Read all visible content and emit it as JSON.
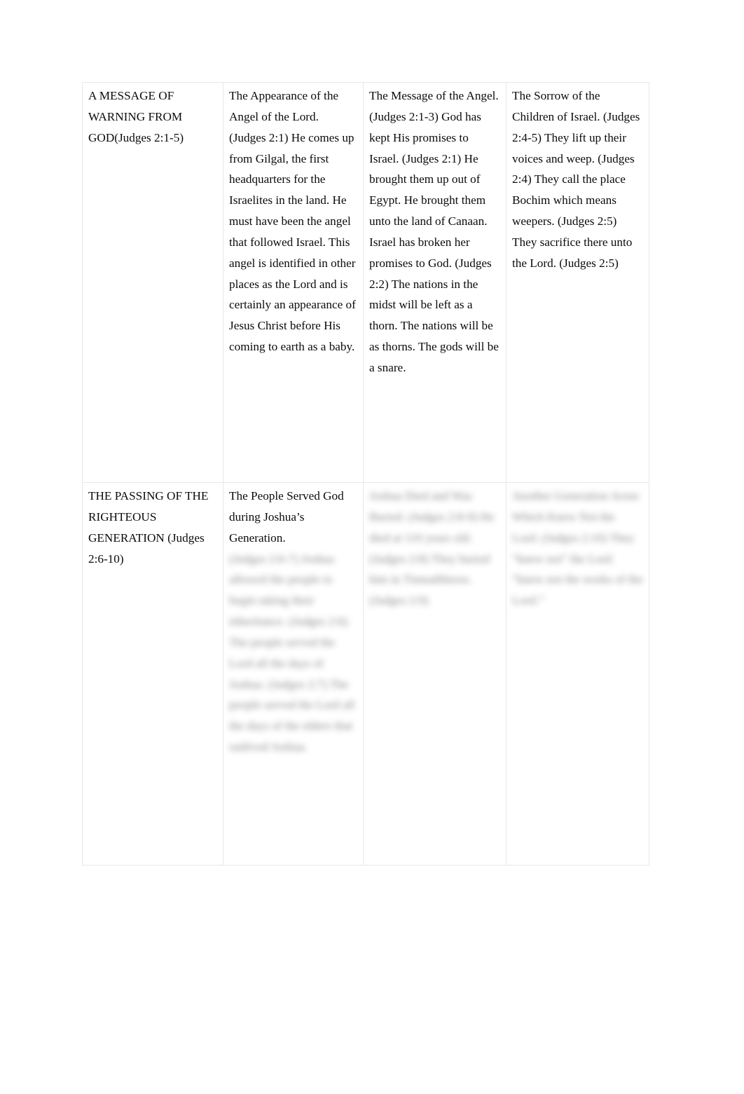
{
  "document": {
    "type": "table",
    "page_background": "#ffffff",
    "text_color": "#0b0b0b",
    "border_color": "#e8e8e8",
    "columns": 4,
    "rows": 2
  },
  "table": {
    "rows": [
      {
        "row_name": "message-of-warning-row",
        "cells": [
          {
            "name": "section-heading-cell",
            "clear": "A MESSAGE OF WARNING FROM GOD(Judges 2:1-5)",
            "blurred": "",
            "obscured": false
          },
          {
            "name": "appearance-of-the-angel-cell",
            "clear": "The Appearance of the Angel of the Lord. (Judges 2:1) He comes up from Gilgal, the first headquarters for the Israelites in the land. He must have been the angel that followed Israel. This angel is identified in other places as the Lord and is certainly an appearance of Jesus Christ before His coming to earth as a baby.",
            "blurred": "",
            "obscured": false
          },
          {
            "name": "message-of-the-angel-cell",
            "clear": "The Message of the Angel. (Judges 2:1-3) God has kept His promises to Israel. (Judges 2:1) He brought them up out of Egypt. He brought them unto the land of Canaan. Israel has broken her promises to God. (Judges 2:2) The nations in the midst will be left as a thorn. The nations will be as thorns. The gods will be a snare.",
            "blurred": "",
            "obscured": false
          },
          {
            "name": "sorrow-of-the-children-of-israel-cell",
            "clear": "The Sorrow of the Children of Israel. (Judges 2:4-5) They lift up their voices and weep. (Judges 2:4) They call the place Bochim which means weepers. (Judges 2:5) They sacrifice there unto the Lord. (Judges 2:5)",
            "blurred": "",
            "obscured": false
          }
        ]
      },
      {
        "row_name": "passing-of-the-righteous-generation-row",
        "cells": [
          {
            "name": "section-heading-cell",
            "clear": "THE PASSING OF THE RIGHTEOUS GENERATION (Judges 2:6-10)",
            "blurred": "",
            "obscured": false
          },
          {
            "name": "people-served-god-cell",
            "clear": "The People Served God during Joshua’s Generation.",
            "blurred": "(Judges 2:6-7) Joshua allowed the people to begin taking their inheritance. (Judges 2:6) The people served the Lord all the days of Joshua. (Judges 2:7) The people served the Lord all the days of the elders that outlived Joshua.",
            "obscured": true
          },
          {
            "name": "joshua-died-cell",
            "clear": "",
            "blurred": "Joshua Died and Was Buried. (Judges 2:8-9) He died at 110 years old. (Judges 2:8) They buried him in Timnathheres. (Judges 2:9)",
            "obscured": true
          },
          {
            "name": "another-generation-arose-cell",
            "clear": "",
            "blurred": "Another Generation Arose Which Knew Not the Lord. (Judges 2:10) They “knew not” the Lord. “knew not the works of the Lord.”",
            "obscured": true
          }
        ]
      }
    ]
  }
}
